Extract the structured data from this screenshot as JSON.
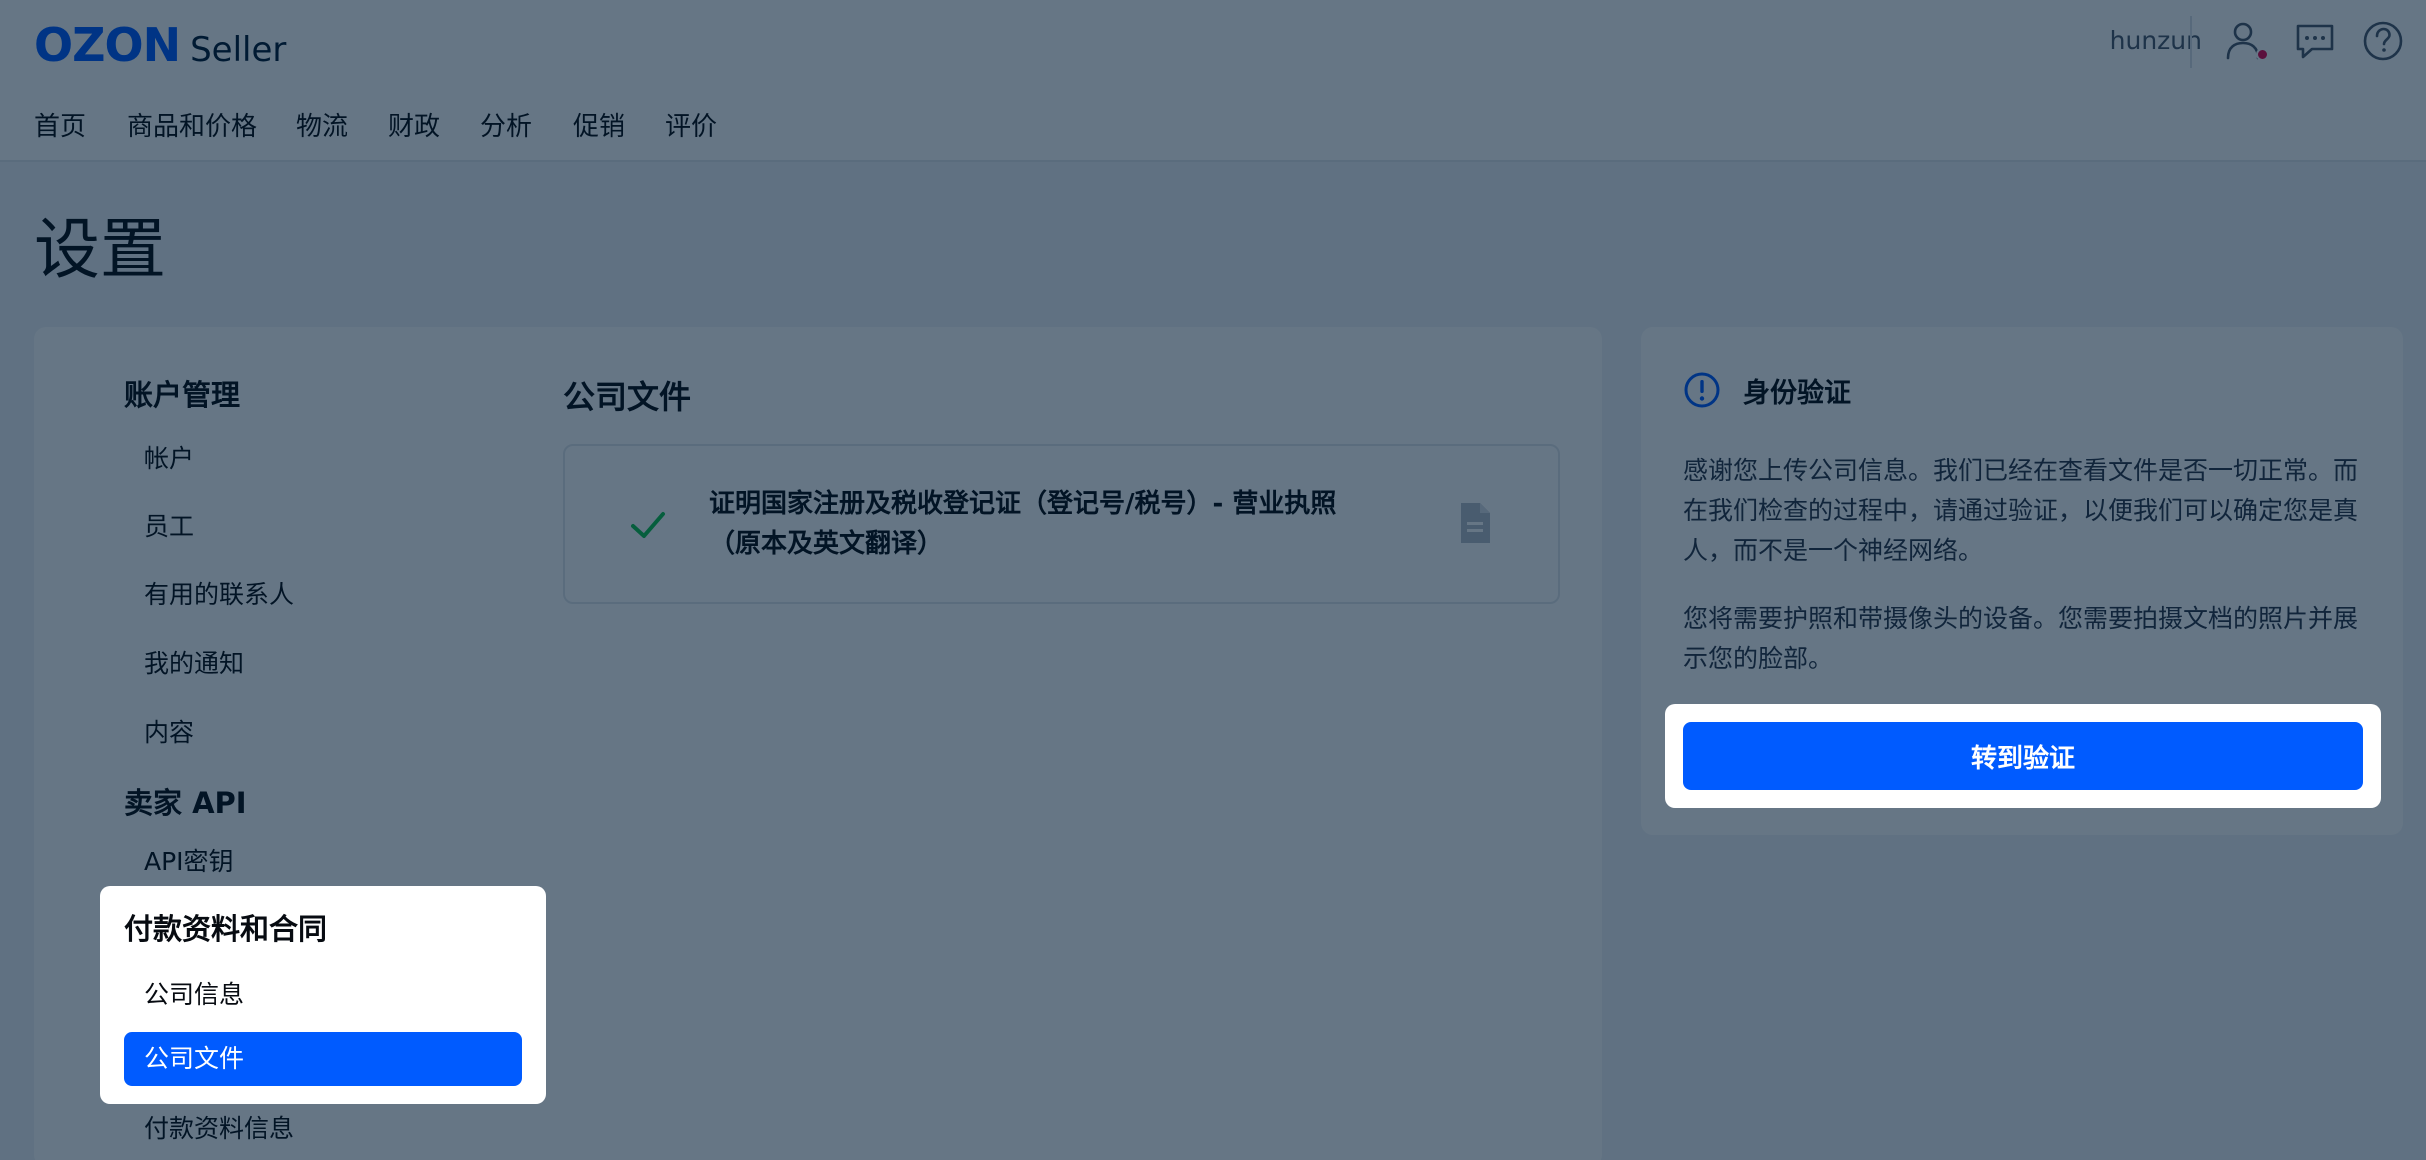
{
  "header": {
    "logo_brand": "OZON",
    "logo_product": "Seller",
    "username": "hunzun",
    "icons": [
      "user-icon",
      "chat-icon",
      "help-icon"
    ],
    "notification_color": "#e4004b"
  },
  "nav": {
    "items": [
      {
        "label": "首页"
      },
      {
        "label": "商品和价格"
      },
      {
        "label": "物流"
      },
      {
        "label": "财政"
      },
      {
        "label": "分析"
      },
      {
        "label": "促销"
      },
      {
        "label": "评价"
      }
    ]
  },
  "page_title": "设置",
  "sidebar": {
    "sections": [
      {
        "title": "账户管理",
        "items": [
          {
            "label": "帐户"
          },
          {
            "label": "员工"
          },
          {
            "label": "有用的联系人"
          },
          {
            "label": "我的通知"
          },
          {
            "label": "内容"
          }
        ]
      },
      {
        "title": "卖家 API",
        "items": [
          {
            "label": "API密钥"
          }
        ]
      },
      {
        "title": "付款资料和合同",
        "items": [
          {
            "label": "公司信息"
          },
          {
            "label": "公司文件",
            "active": true
          },
          {
            "label": "付款资料信息"
          }
        ]
      }
    ]
  },
  "main": {
    "section_title": "公司文件",
    "document": {
      "status": "check-icon",
      "title": "证明国家注册及税收登记证（登记号/税号）- 营业执照（原本及英文翻译）",
      "action_icon": "file-icon"
    }
  },
  "verification": {
    "title": "身份验证",
    "paragraph1": "感谢您上传公司信息。我们已经在查看文件是否一切正常。而在我们检查的过程中，请通过验证，以便我们可以确定您是真人，而不是一个神经网络。",
    "paragraph2": "您将需要护照和带摄像头的设备。您需要拍摄文档的照片并展示您的脸部。",
    "button_label": "转到验证"
  },
  "colors": {
    "accent": "#005bff",
    "success": "#10c44c",
    "text": "#070b11",
    "overlay": "rgba(0, 26, 52, 0.6)"
  }
}
